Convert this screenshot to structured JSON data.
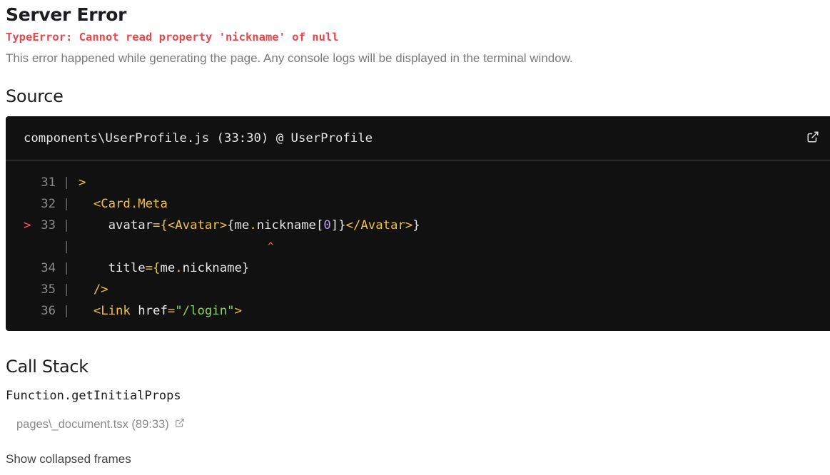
{
  "title": "Server Error",
  "error": "TypeError: Cannot read property 'nickname' of null",
  "description": "This error happened while generating the page. Any console logs will be displayed in the terminal window.",
  "source": {
    "heading": "Source",
    "file": "components\\UserProfile.js (33:30) @ UserProfile",
    "marker": ">",
    "caret": "^",
    "lines": [
      {
        "num": "31",
        "t": [
          ">"
        ]
      },
      {
        "num": "32",
        "t": [
          "  ",
          "<Card.Meta"
        ]
      },
      {
        "num": "33",
        "t": [
          "    avatar",
          "={",
          "<Avatar>",
          "{me",
          ".",
          "nickname[",
          "0",
          "]}",
          "</Avatar>",
          "}"
        ]
      },
      {
        "num": "34",
        "t": [
          "    title",
          "={",
          "me",
          ".",
          "nickname}"
        ]
      },
      {
        "num": "35",
        "t": [
          "  ",
          "/>"
        ]
      },
      {
        "num": "36",
        "t": [
          "  ",
          "<Link",
          " href",
          "=",
          "\"/login\"",
          ">"
        ]
      }
    ]
  },
  "callstack": {
    "heading": "Call Stack",
    "function": "Function.getInitialProps",
    "frame": "pages\\_document.tsx (89:33)",
    "show_collapsed": "Show collapsed frames"
  },
  "colors": {
    "error": "#e5484d",
    "keyword": "#f0c040",
    "string": "#8fd16a",
    "number": "#b69cf2"
  }
}
